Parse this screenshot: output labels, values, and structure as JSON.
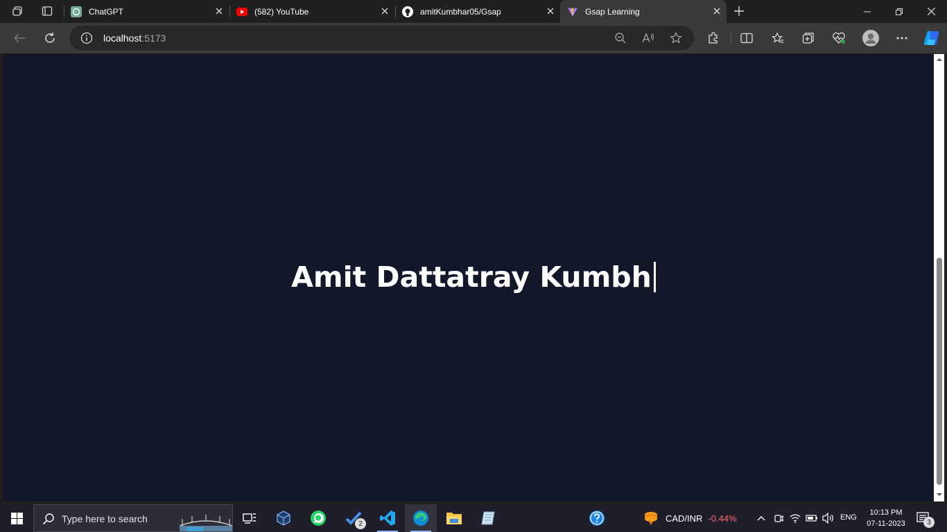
{
  "browser": {
    "tabs": [
      {
        "title": "ChatGPT",
        "icon": "chatgpt-icon"
      },
      {
        "title": "(582) YouTube",
        "icon": "youtube-icon"
      },
      {
        "title": "amitKumbhar05/Gsap",
        "icon": "github-icon"
      },
      {
        "title": "Gsap Learning",
        "icon": "vite-icon",
        "active": true
      }
    ],
    "address": {
      "host": "localhost",
      "port": ":5173"
    }
  },
  "page": {
    "headline": "Amit Dattatray Kumbh",
    "background": "#121829",
    "text_color": "#ffffff"
  },
  "taskbar": {
    "search_placeholder": "Type here to search",
    "todo_badge": "2",
    "ticker": {
      "symbol": "CAD/INR",
      "change": "-0.44%"
    },
    "language": "ENG",
    "time": "10:13 PM",
    "date": "07-11-2023",
    "notification_count": "3"
  }
}
